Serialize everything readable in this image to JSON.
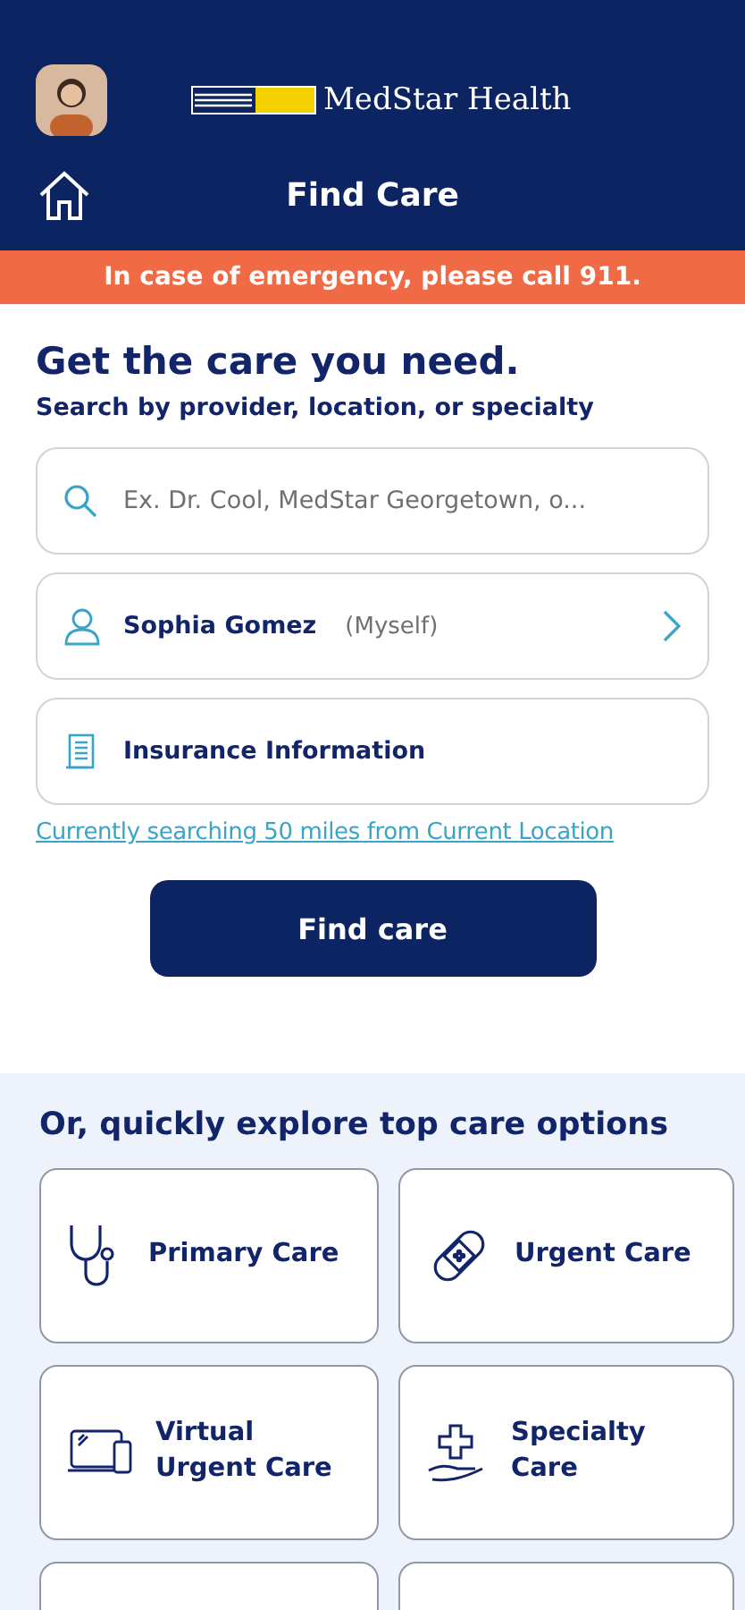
{
  "header": {
    "logo_text": "MedStar Health",
    "title": "Find Care"
  },
  "banner": "In case of emergency, please call 911.",
  "search": {
    "heading": "Get the care you need.",
    "subheading": "Search by provider, location, or specialty",
    "placeholder": "Ex. Dr. Cool, MedStar Georgetown, o...",
    "patient_name": "Sophia Gomez",
    "patient_relation": "(Myself)",
    "insurance": "Insurance Information",
    "location_link": "Currently searching 50 miles from Current Location",
    "button": "Find care"
  },
  "explore": {
    "heading": "Or, quickly explore top care options",
    "cards": [
      {
        "kind": "stethoscope",
        "label": "Primary Care"
      },
      {
        "kind": "bandage",
        "label": "Urgent Care"
      },
      {
        "kind": "devices",
        "label": "Virtual Urgent Care"
      },
      {
        "kind": "hand",
        "label": "Specialty Care"
      },
      {
        "kind": "blank"
      },
      {
        "kind": "blank"
      }
    ]
  }
}
